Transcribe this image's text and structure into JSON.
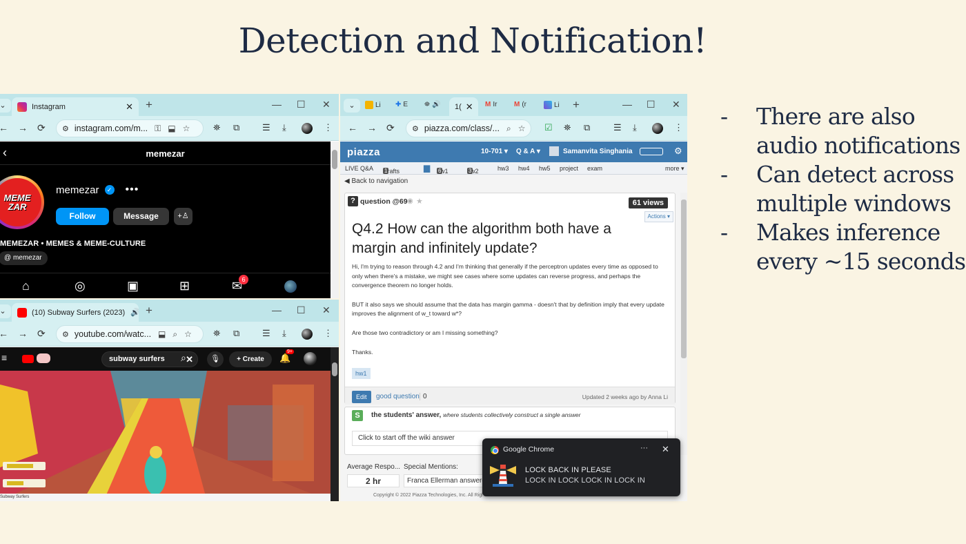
{
  "slide": {
    "title": "Detection and Notification!",
    "bullets": [
      {
        "dash": "-",
        "text": "There are also audio notifications"
      },
      {
        "dash": "-",
        "text": "Can detect across multiple windows"
      },
      {
        "dash": "-",
        "text": "Makes inference every ~15 seconds"
      }
    ]
  },
  "instagram_window": {
    "tab_title": "Instagram",
    "url": "instagram.com/m...",
    "username_header": "memezar",
    "username": "memezar",
    "logo_line1": "MEME",
    "logo_line2": "ZAR",
    "more": "•••",
    "follow_label": "Follow",
    "message_label": "Message",
    "bio": "MEMEZAR • MEMES & MEME-CULTURE",
    "threads_handle": "memezar",
    "messages_badge": "6"
  },
  "youtube_window": {
    "tab_title": "(10) Subway Surfers (2023)",
    "url": "youtube.com/watc...",
    "search_value": "subway surfers",
    "create_label": "Create",
    "notif_badge": "9+",
    "game_caption": "Subway Surfers"
  },
  "piazza_window": {
    "tab_title": "1(",
    "url": "piazza.com/class/...",
    "course": "10-701 ▾",
    "qa_menu": "Q & A ▾",
    "user_name": "Samanvita Singhania",
    "logo": "piazza",
    "subnav": {
      "live": "LIVE Q&A",
      "drafts": "Drafts",
      "drafts_count": "1",
      "hw1": "hw1",
      "hw1_count": "6",
      "hw2": "hw2",
      "hw2_count": "3",
      "hw3": "hw3",
      "hw4": "hw4",
      "hw5": "hw5",
      "project": "project",
      "exam": "exam",
      "more": "more ▾"
    },
    "back_nav": "Back to navigation",
    "question_label": "question @69",
    "views": "61 views",
    "actions": "Actions ▾",
    "question_title": "Q4.2 How can the algorithm both have a margin and infinitely update?",
    "body": [
      "Hi, I'm trying to reason through 4.2 and I'm thinking that generally if the perceptron updates every time as opposed to only when there's a mistake, we might see cases where some updates can reverse progress, and perhaps the convergence theorem no longer holds.",
      "BUT it also says we should assume that the data has margin gamma - doesn't that by definition imply that every update improves the alignment of w_t toward w*?",
      "Are those two contradictory or am I missing something?",
      "Thanks."
    ],
    "tag": "hw1",
    "edit_label": "Edit",
    "good_question": "good question",
    "good_count": "0",
    "updated": "Updated 2 weeks ago by Anna Li",
    "answer_heading": "the students' answer,",
    "answer_sub": "where students collectively construct a single answer",
    "wiki_placeholder": "Click to start off the wiki answer",
    "avg_response_label": "Average Respo...",
    "avg_response_value": "2 hr",
    "special_mentions_label": "Special Mentions:",
    "special_mentions_value": "Franca Ellerman answered",
    "copyright": "Copyright © 2022 Piazza Technologies, Inc. All Rights Reserved."
  },
  "notification": {
    "app": "Google Chrome",
    "title": "LOCK BACK IN PLEASE",
    "message": "LOCK IN LOCK LOCK IN LOCK IN",
    "more": "···",
    "close": "✕"
  }
}
